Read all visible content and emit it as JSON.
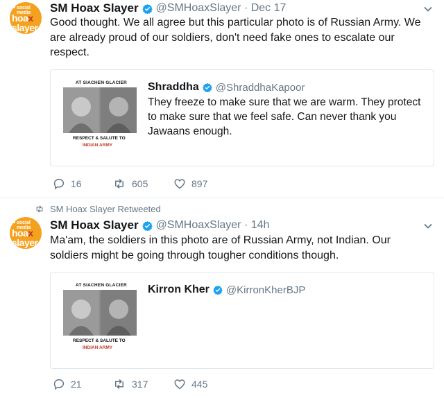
{
  "tweet1": {
    "avatar": {
      "line1": "social media",
      "line2a": "hoa",
      "line2x": "x",
      "line2b": "slayer"
    },
    "name": "SM Hoax Slayer",
    "handle": "@SMHoaxSlayer · Dec 17",
    "text": "Good thought. We all agree but this particular photo is of Russian Army. We are already proud of our soldiers, don't need fake ones to escalate our respect.",
    "quote": {
      "thumb_top": "AT SIACHEN GLACIER",
      "thumb_mid": "RESPECT & SALUTE TO",
      "thumb_bot": "INDIAN ARMY",
      "name": "Shraddha",
      "handle": "@ShraddhaKapoor",
      "text": "They freeze to make sure that we are warm. They protect to make sure that we feel safe. Can never thank you Jawaans enough."
    },
    "actions": {
      "replies": "16",
      "retweets": "605",
      "likes": "897"
    }
  },
  "tweet2": {
    "retweet_label": "SM Hoax Slayer Retweeted",
    "name": "SM Hoax Slayer",
    "handle": "@SMHoaxSlayer · 14h",
    "text": "Ma'am, the soldiers in this photo are of Russian Army, not Indian. Our soldiers might be going through tougher conditions though.",
    "quote": {
      "thumb_top": "AT SIACHEN GLACIER",
      "thumb_mid": "RESPECT & SALUTE TO",
      "thumb_bot": "INDIAN ARMY",
      "name": "Kirron Kher",
      "handle": "@KirronKherBJP"
    },
    "actions": {
      "replies": "21",
      "retweets": "317",
      "likes": "445"
    }
  },
  "colors": {
    "accent": "#1da1f2",
    "avatar": "#f4a11f",
    "muted": "#657786",
    "border": "#e1e8ed"
  }
}
